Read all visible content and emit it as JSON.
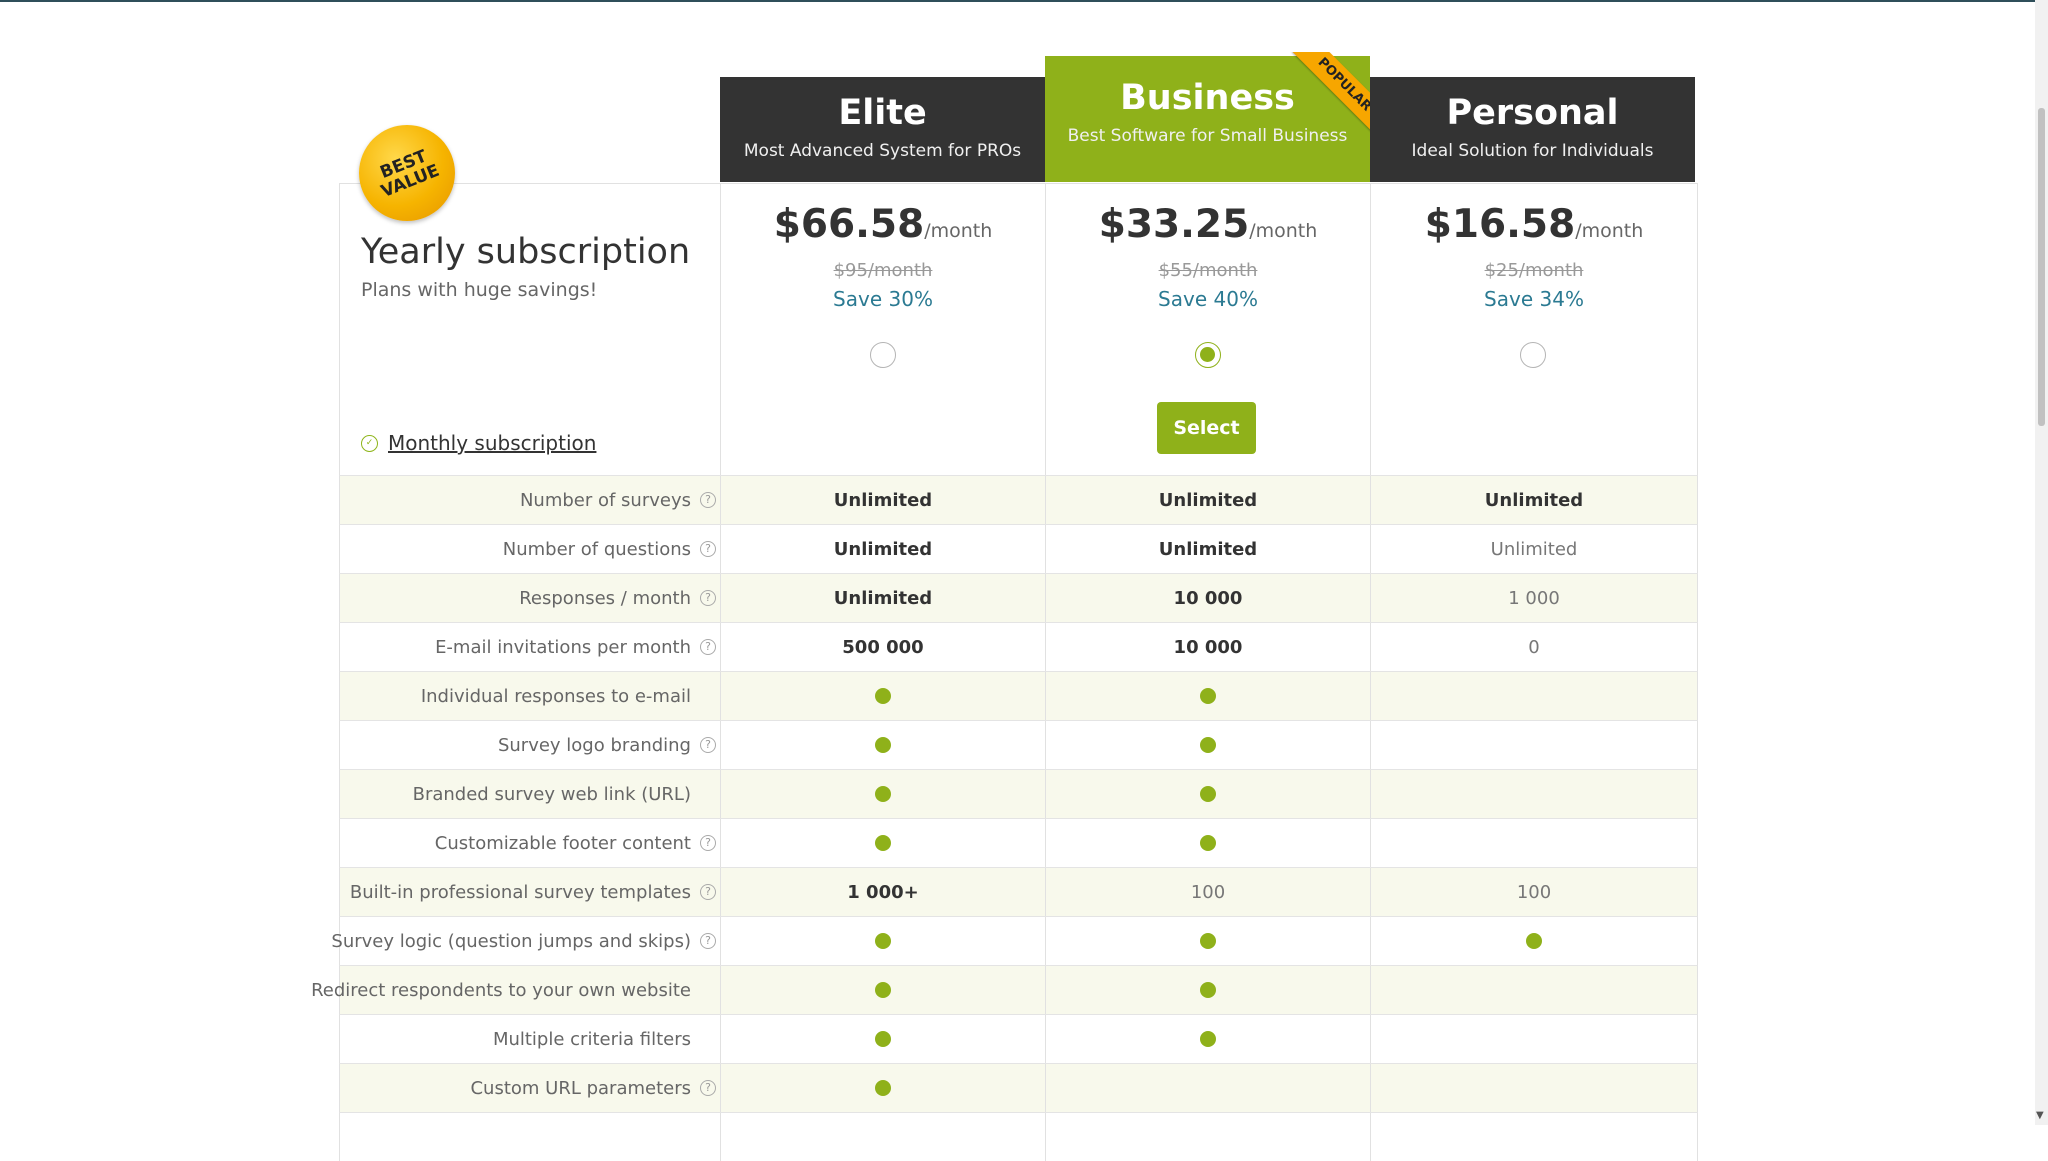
{
  "badge": {
    "best_value": "BEST VALUE"
  },
  "subscription": {
    "title": "Yearly subscription",
    "subtitle": "Plans with huge savings!",
    "monthly_link": "Monthly subscription"
  },
  "plans": [
    {
      "name": "Elite",
      "tagline": "Most Advanced System for PROs",
      "price": "$66.58",
      "unit": "/month",
      "old_price": "$95/month",
      "save": "Save 30%",
      "selected": false
    },
    {
      "name": "Business",
      "tagline": "Best Software for Small Business",
      "price": "$33.25",
      "unit": "/month",
      "old_price": "$55/month",
      "save": "Save 40%",
      "selected": true,
      "ribbon": "POPULAR",
      "select_label": "Select"
    },
    {
      "name": "Personal",
      "tagline": "Ideal Solution for Individuals",
      "price": "$16.58",
      "unit": "/month",
      "old_price": "$25/month",
      "save": "Save 34%",
      "selected": false
    }
  ],
  "features": [
    {
      "label": "Number of surveys",
      "help": true,
      "values": [
        {
          "type": "text",
          "text": "Unlimited",
          "bold": true
        },
        {
          "type": "text",
          "text": "Unlimited",
          "bold": true
        },
        {
          "type": "text",
          "text": "Unlimited",
          "bold": true
        }
      ]
    },
    {
      "label": "Number of questions",
      "help": true,
      "values": [
        {
          "type": "text",
          "text": "Unlimited",
          "bold": true
        },
        {
          "type": "text",
          "text": "Unlimited",
          "bold": true
        },
        {
          "type": "text",
          "text": "Unlimited",
          "bold": false
        }
      ]
    },
    {
      "label": "Responses / month",
      "help": true,
      "values": [
        {
          "type": "text",
          "text": "Unlimited",
          "bold": true
        },
        {
          "type": "text",
          "text": "10 000",
          "bold": true
        },
        {
          "type": "text",
          "text": "1 000",
          "bold": false
        }
      ]
    },
    {
      "label": "E-mail invitations per month",
      "help": true,
      "values": [
        {
          "type": "text",
          "text": "500 000",
          "bold": true
        },
        {
          "type": "text",
          "text": "10 000",
          "bold": true
        },
        {
          "type": "text",
          "text": "0",
          "bold": false
        }
      ]
    },
    {
      "label": "Individual responses to e-mail",
      "help": false,
      "values": [
        {
          "type": "dot"
        },
        {
          "type": "dot"
        },
        {
          "type": "empty"
        }
      ]
    },
    {
      "label": "Survey logo branding",
      "help": true,
      "values": [
        {
          "type": "dot"
        },
        {
          "type": "dot"
        },
        {
          "type": "empty"
        }
      ]
    },
    {
      "label": "Branded survey web link (URL)",
      "help": false,
      "values": [
        {
          "type": "dot"
        },
        {
          "type": "dot"
        },
        {
          "type": "empty"
        }
      ]
    },
    {
      "label": "Customizable footer content",
      "help": true,
      "values": [
        {
          "type": "dot"
        },
        {
          "type": "dot"
        },
        {
          "type": "empty"
        }
      ]
    },
    {
      "label": "Built-in professional survey templates",
      "help": true,
      "values": [
        {
          "type": "text",
          "text": "1 000+",
          "bold": true
        },
        {
          "type": "text",
          "text": "100",
          "bold": false
        },
        {
          "type": "text",
          "text": "100",
          "bold": false
        }
      ]
    },
    {
      "label": "Survey logic (question jumps and skips)",
      "help": true,
      "values": [
        {
          "type": "dot"
        },
        {
          "type": "dot"
        },
        {
          "type": "dot"
        }
      ]
    },
    {
      "label": "Redirect respondents to your own website",
      "help": false,
      "values": [
        {
          "type": "dot"
        },
        {
          "type": "dot"
        },
        {
          "type": "empty"
        }
      ]
    },
    {
      "label": "Multiple criteria filters",
      "help": false,
      "values": [
        {
          "type": "dot"
        },
        {
          "type": "dot"
        },
        {
          "type": "empty"
        }
      ]
    },
    {
      "label": "Custom URL parameters",
      "help": true,
      "values": [
        {
          "type": "dot"
        },
        {
          "type": "empty"
        },
        {
          "type": "empty"
        }
      ]
    },
    {
      "label": "",
      "help": false,
      "values": [
        {
          "type": "empty"
        },
        {
          "type": "empty"
        },
        {
          "type": "empty"
        }
      ]
    }
  ],
  "icons": {
    "help": "question-circle-icon",
    "check": "check-circle-icon",
    "included": "green-dot-icon"
  },
  "colors": {
    "accent_green": "#8fb11a",
    "header_dark": "#333333",
    "save_blue": "#2b7a92",
    "ribbon_orange": "#f7a600",
    "row_alt": "#f8f9ec"
  }
}
